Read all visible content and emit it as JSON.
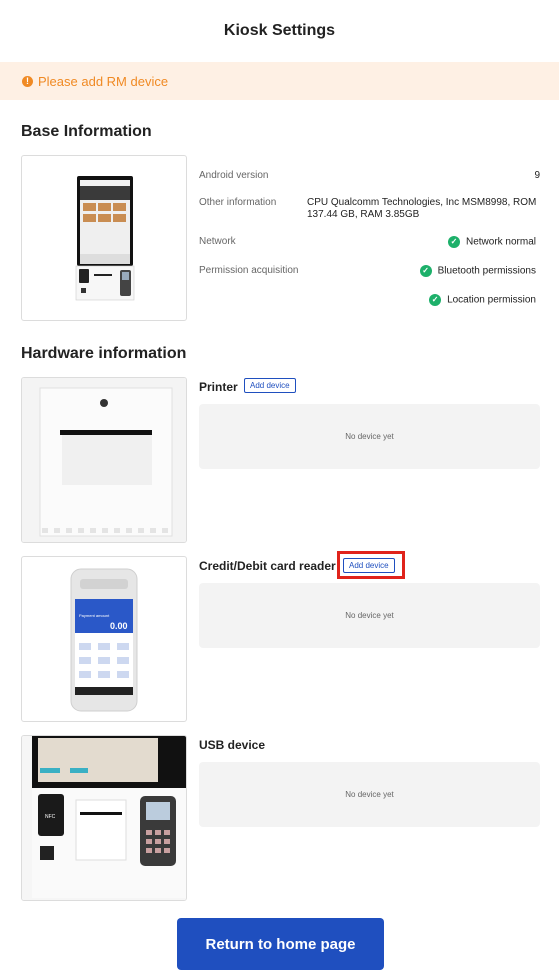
{
  "header": {
    "title": "Kiosk Settings"
  },
  "warning": {
    "icon": "exclamation-icon",
    "text": "Please add RM device",
    "color": "#f08a24"
  },
  "base": {
    "title": "Base Information",
    "android_label": "Android version",
    "android_value": "9",
    "other_label": "Other information",
    "other_value_line1": "CPU Qualcomm Technologies, Inc MSM8998, ROM",
    "other_value_line2": "137.44 GB, RAM 3.85GB",
    "network_label": "Network",
    "network_value": "Network normal",
    "permission_label": "Permission acquisition",
    "permissions": [
      "Bluetooth permissions",
      "Location permission"
    ]
  },
  "hardware": {
    "title": "Hardware information",
    "printer": {
      "title": "Printer",
      "add_label": "Add device",
      "empty": "No device yet"
    },
    "card_reader": {
      "title": "Credit/Debit card reader",
      "add_label": "Add device",
      "empty": "No device yet"
    },
    "usb": {
      "title": "USB device",
      "empty": "No device yet"
    }
  },
  "pos_screen": {
    "amount": "0.00",
    "label": "Payment amount"
  },
  "footer": {
    "return_label": "Return to home page"
  },
  "colors": {
    "accent": "#1f4fbf",
    "success": "#1db06a",
    "warning_bg": "#fef0e4",
    "highlight": "#e0231b"
  }
}
